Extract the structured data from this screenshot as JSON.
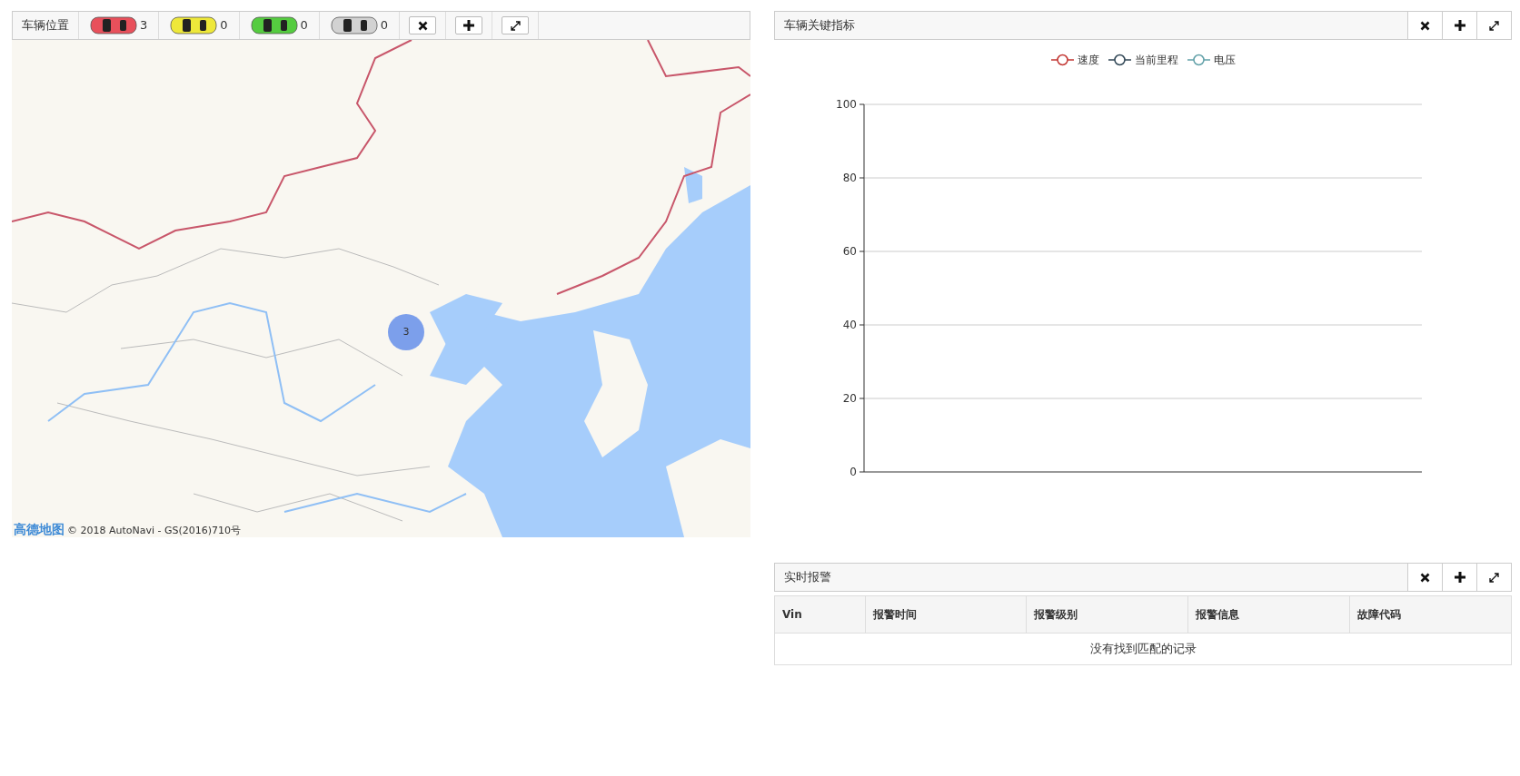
{
  "map_panel": {
    "title": "车辆位置",
    "vehicle_counts": [
      {
        "color": "#e8505b",
        "count": "3"
      },
      {
        "color": "#eee83a",
        "count": "0"
      },
      {
        "color": "#55cc40",
        "count": "0"
      },
      {
        "color": "#d2d2d2",
        "count": "0"
      }
    ],
    "buttons": [
      {
        "kind": "close"
      },
      {
        "kind": "add"
      },
      {
        "kind": "expand"
      }
    ],
    "map": {
      "cluster": "3",
      "logo": "高德地图",
      "attribution": "© 2018 AutoNavi - GS(2016)710号"
    }
  },
  "metrics_panel": {
    "title": "车辆关键指标",
    "buttons": [
      {
        "kind": "close"
      },
      {
        "kind": "add"
      },
      {
        "kind": "expand"
      }
    ],
    "chart_data": {
      "type": "line",
      "grid": true,
      "series": [
        {
          "name": "速度",
          "color": "#c23531"
        },
        {
          "name": "当前里程",
          "color": "#2f4554"
        },
        {
          "name": "电压",
          "color": "#61a0a8"
        }
      ],
      "ylim": [
        0,
        100
      ],
      "yticks": [
        0,
        20,
        40,
        60,
        80,
        100
      ]
    }
  },
  "alarm_panel": {
    "title": "实时报警",
    "buttons": [
      {
        "kind": "close"
      },
      {
        "kind": "add"
      },
      {
        "kind": "expand"
      }
    ],
    "table": {
      "columns": [
        "Vin",
        "报警时间",
        "报警级别",
        "报警信息",
        "故障代码"
      ],
      "empty_message": "没有找到匹配的记录"
    }
  }
}
